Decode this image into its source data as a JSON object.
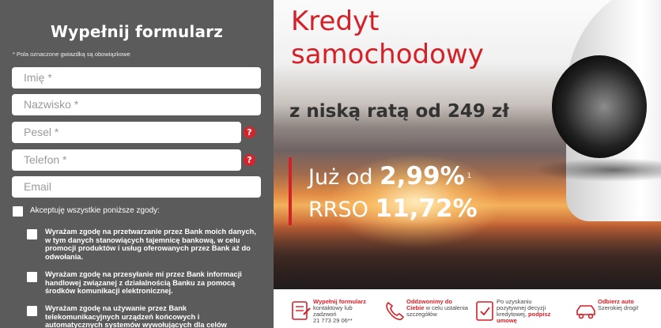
{
  "form": {
    "title": "Wypełnij formularz",
    "required_note": "* Pola oznaczone gwiazdką są obowiązkowe",
    "fields": {
      "first_name": "Imię *",
      "last_name": "Nazwisko *",
      "pesel": "Pesel *",
      "phone": "Telefon *",
      "email": "Email"
    },
    "error_glyph": "?",
    "accept_all": "Akceptuję wszystkie poniższe zgody:",
    "consents": [
      "Wyrażam zgodę na przetwarzanie przez Bank moich danych, w tym danych stanowiących tajemnicę bankową, w celu promocji produktów i usług oferowanych przez Bank aż do odwołania.",
      "Wyrażam zgodę na przesyłanie mi przez Bank informacji handlowej związanej z działalnością Banku za pomocą środków komunikacji elektronicznej.",
      "Wyrażam zgodę na używanie przez Bank telekomunikacyjnych urządzeń końcowych i automatycznych systemów wywołujących dla celów"
    ]
  },
  "banner": {
    "headline_1": "Kredyt",
    "headline_2": "samochodowy",
    "subhead": "z niską ratą od 249 zł",
    "rate_prefix": "Już od",
    "rate_value": "2,99%",
    "rate_footnote": "1",
    "rrso_prefix": "RRSO",
    "rrso_value": "11,72%"
  },
  "steps": [
    {
      "icon": "form-icon",
      "bold": "Wypełnij formularz",
      "rest": "kontaktowy lub zadzwoń",
      "extra": "21 773 29 06**"
    },
    {
      "icon": "phone-icon",
      "bold": "Oddzwonimy do Ciebie",
      "rest": "w celu ustalenia szczegółów",
      "extra": ""
    },
    {
      "icon": "document-check-icon",
      "pre": "Po uzyskaniu pozytywnej decyzji kredytowej,",
      "bold": "podpisz umowę",
      "extra": ""
    },
    {
      "icon": "car-icon",
      "bold": "Odbierz auto",
      "rest": "Szerokiej drogi!",
      "extra": ""
    }
  ],
  "colors": {
    "accent": "#d61f26",
    "panel": "#5b5b5b"
  }
}
